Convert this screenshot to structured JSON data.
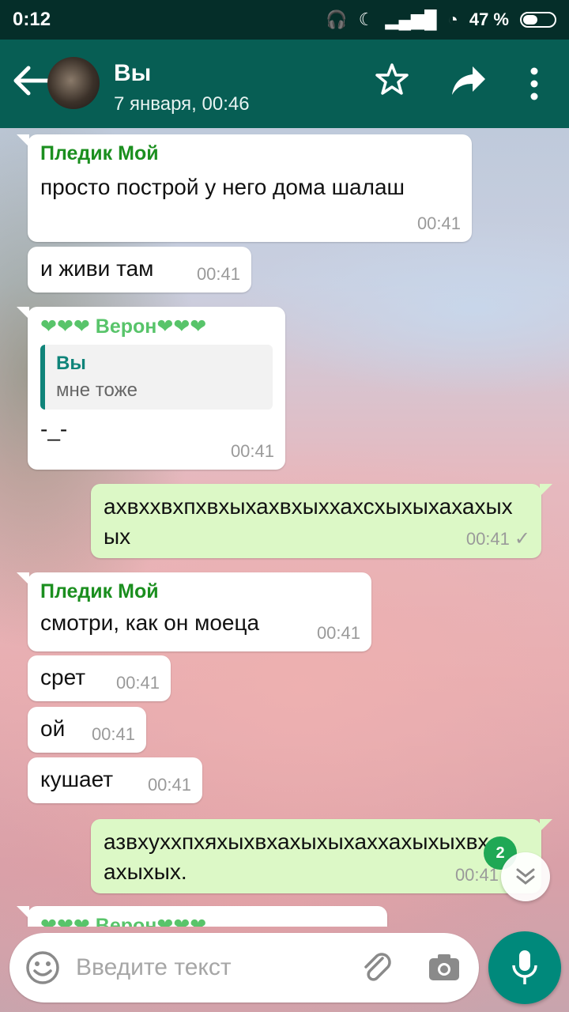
{
  "statusbar": {
    "time": "0:12",
    "battery": "47 %"
  },
  "header": {
    "title": "Вы",
    "subtitle": "7 января, 00:46"
  },
  "messages": [
    {
      "sender": "Пледик Мой",
      "text": "просто построй у него дома шалаш",
      "time": "00:41"
    },
    {
      "text": "и живи там",
      "time": "00:41"
    },
    {
      "sender": "❤❤❤ Верон❤❤❤",
      "quote_author": "Вы",
      "quote_text": "мне тоже",
      "text": "-_-",
      "time": "00:41"
    },
    {
      "text": "ахвххвхпхвхыхахвхыххахсхыхыхахахыхых",
      "time": "00:41",
      "status": "✓"
    },
    {
      "sender": "Пледик Мой",
      "text": "смотри, как он моеца",
      "time": "00:41"
    },
    {
      "text": "срет",
      "time": "00:41"
    },
    {
      "text": "ой",
      "time": "00:41"
    },
    {
      "text": "кушает",
      "time": "00:41"
    },
    {
      "text": "азвхуххпхяхыхвхахыхыхаххахыхыхвхахыхых.",
      "time": "00:41"
    },
    {
      "sender": "❤❤❤ Верон❤❤❤"
    }
  ],
  "unread_count": "2",
  "composer": {
    "placeholder": "Введите текст"
  },
  "colors": {
    "appbar": "#075e54",
    "statusbar": "#052e29",
    "outgoing": "#dcf8c6",
    "accent": "#00897b"
  },
  "icons": [
    "back-arrow-icon",
    "star-icon",
    "share-icon",
    "more-vert-icon",
    "emoji-icon",
    "attach-icon",
    "camera-icon",
    "mic-icon",
    "chevron-down-icon"
  ]
}
